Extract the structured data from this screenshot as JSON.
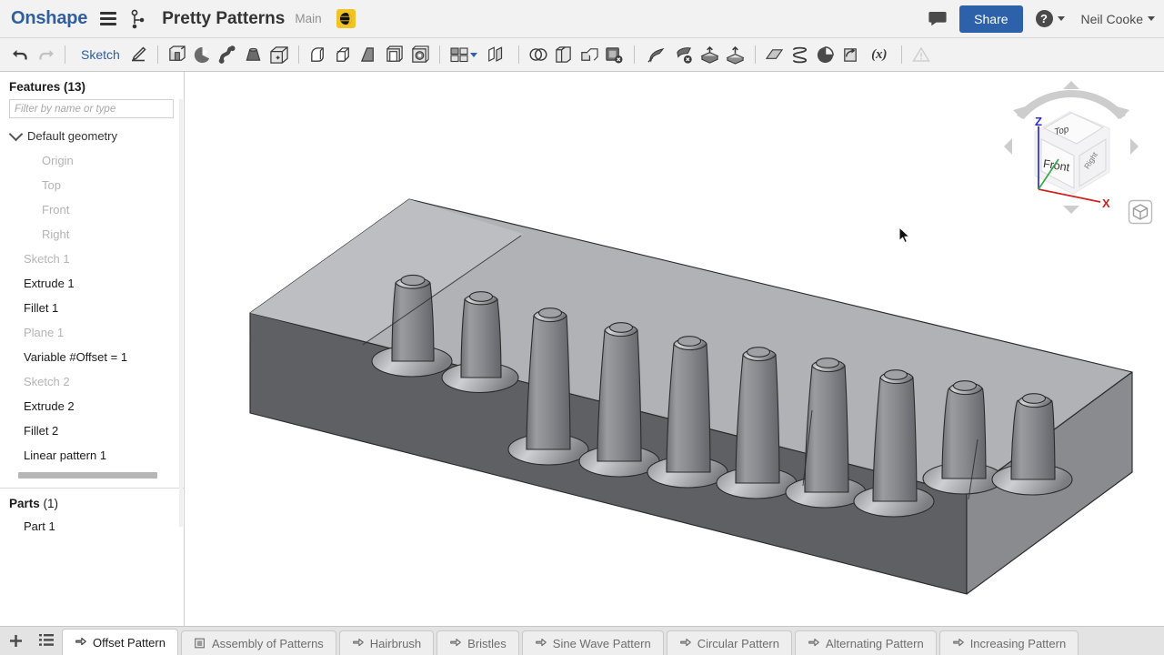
{
  "app": {
    "brand": "Onshape",
    "document_title": "Pretty Patterns",
    "workspace": "Main",
    "public_badge_icon": "globe-icon"
  },
  "topbar": {
    "comment_icon": "comment-icon",
    "share_label": "Share",
    "help_label": "?",
    "user_name": "Neil Cooke",
    "share_color": "#2d62ab"
  },
  "toolbar": {
    "undo_icon": "undo-arrow-icon",
    "redo_icon": "redo-arrow-icon",
    "sketch_label": "Sketch",
    "sketch_icon": "pencil-icon",
    "tools": [
      {
        "name": "extrude-icon"
      },
      {
        "name": "revolve-icon"
      },
      {
        "name": "sweep-icon"
      },
      {
        "name": "loft-icon"
      },
      {
        "name": "thicken-icon"
      },
      {
        "name": "fillet-icon"
      },
      {
        "name": "chamfer-icon"
      },
      {
        "name": "draft-icon"
      },
      {
        "name": "shell-icon"
      },
      {
        "name": "hole-icon"
      },
      {
        "name": "pattern-icon"
      },
      {
        "name": "pattern-dropdown-caret"
      },
      {
        "name": "mirror-icon"
      },
      {
        "name": "boolean-icon"
      },
      {
        "name": "split-icon"
      },
      {
        "name": "transform-icon"
      },
      {
        "name": "delete-face-icon"
      },
      {
        "name": "move-face-icon"
      },
      {
        "name": "delete-part-icon"
      },
      {
        "name": "import-icon"
      },
      {
        "name": "export-icon"
      },
      {
        "name": "plane-icon"
      },
      {
        "name": "helix-icon"
      },
      {
        "name": "sketch-curve-icon"
      },
      {
        "name": "derive-icon"
      },
      {
        "name": "variable-icon"
      },
      {
        "name": "warning-icon"
      }
    ],
    "variable_label": "(x)"
  },
  "sidebar": {
    "features_header_bold": "Features",
    "features_header_count": "(13)",
    "filter_placeholder": "Filter by name or type",
    "filter_value": "",
    "default_geometry_label": "Default geometry",
    "default_children": [
      "Origin",
      "Top",
      "Front",
      "Right"
    ],
    "features": [
      {
        "label": "Sketch 1",
        "dim": true
      },
      {
        "label": "Extrude 1",
        "dim": false
      },
      {
        "label": "Fillet 1",
        "dim": false
      },
      {
        "label": "Plane 1",
        "dim": true
      },
      {
        "label": "Variable #Offset = 1",
        "dim": false
      },
      {
        "label": "Sketch 2",
        "dim": true
      },
      {
        "label": "Extrude 2",
        "dim": false
      },
      {
        "label": "Fillet 2",
        "dim": false
      },
      {
        "label": "Linear pattern 1",
        "dim": false
      }
    ],
    "parts_header_bold": "Parts",
    "parts_header_count": "(1)",
    "parts": [
      "Part 1"
    ]
  },
  "viewcube": {
    "top_face": "Top",
    "front_face": "Front",
    "right_face": "Right",
    "axis_z": "Z",
    "axis_x": "X",
    "axis_z_color": "#2c2ccc",
    "axis_x_color": "#d21f1f",
    "axis_y_color": "#2faa4a",
    "home_icon": "view-home-cube-icon"
  },
  "model": {
    "description": "Grey CAD solid: rectangular base plate with a row of ten tapered filleted pins",
    "pin_count": 10,
    "face_light": "#b2b4b7",
    "face_mid": "#8e9093",
    "face_dark": "#5e6063",
    "edge_color": "#2b2b2b"
  },
  "tabbar": {
    "add_tab_icon": "plus-icon",
    "tab_list_icon": "list-icon",
    "tabs": [
      {
        "label": "Offset Pattern",
        "icon": "part-studio-icon",
        "active": true
      },
      {
        "label": "Assembly of Patterns",
        "icon": "assembly-icon",
        "active": false
      },
      {
        "label": "Hairbrush",
        "icon": "part-studio-icon",
        "active": false
      },
      {
        "label": "Bristles",
        "icon": "part-studio-icon",
        "active": false
      },
      {
        "label": "Sine Wave Pattern",
        "icon": "part-studio-icon",
        "active": false
      },
      {
        "label": "Circular Pattern",
        "icon": "part-studio-icon",
        "active": false
      },
      {
        "label": "Alternating Pattern",
        "icon": "part-studio-icon",
        "active": false
      },
      {
        "label": "Increasing Pattern",
        "icon": "part-studio-icon",
        "active": false
      }
    ]
  }
}
